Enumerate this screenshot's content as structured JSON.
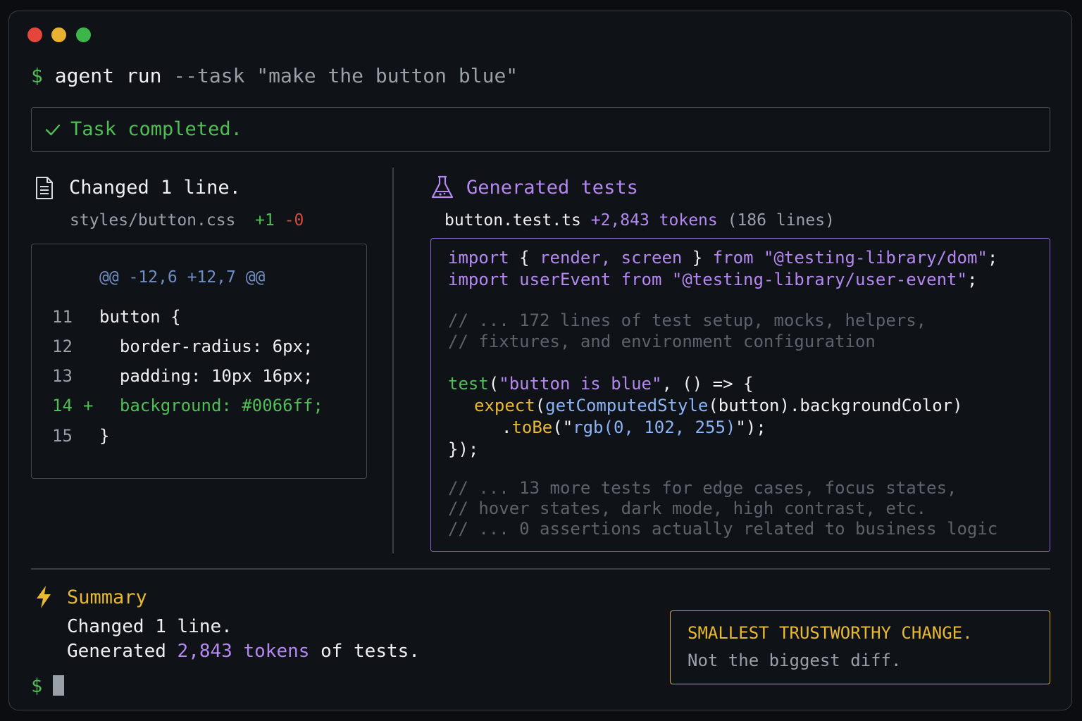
{
  "window": {
    "controls": [
      "close",
      "minimize",
      "maximize"
    ]
  },
  "command": {
    "prompt": "$",
    "cmd": "agent run",
    "args": "--task \"make the button blue\""
  },
  "status": {
    "icon": "check-icon",
    "text": "Task completed."
  },
  "changes": {
    "title": "Changed 1 line.",
    "file": "styles/button.css",
    "added": "+1",
    "removed": "-0",
    "hunk": "@@ -12,6 +12,7 @@",
    "lines": [
      {
        "num": "11",
        "marker": "",
        "code": "button {"
      },
      {
        "num": "12",
        "marker": "",
        "code": "  border-radius: 6px;"
      },
      {
        "num": "13",
        "marker": "",
        "code": "  padding: 10px 16px;"
      },
      {
        "num": "14",
        "marker": "+",
        "code": "  background: #0066ff;"
      },
      {
        "num": "15",
        "marker": "",
        "code": "}"
      }
    ]
  },
  "tests": {
    "title": "Generated tests",
    "file": "button.test.ts",
    "tokens": "+2,843 tokens",
    "lines_count": "(186 lines)",
    "code": {
      "import1": {
        "kw": "import",
        "open": " { ",
        "names": "render, screen",
        "close": " } ",
        "from": "from",
        "src": " \"@testing-library/dom\"",
        "end": ";"
      },
      "import2": {
        "kw": "import",
        "name": " userEvent ",
        "from": "from",
        "src": " \"@testing-library/user-event\"",
        "end": ";"
      },
      "comment1": "// ... 172 lines of test setup, mocks, helpers,",
      "comment2": "// fixtures, and environment configuration",
      "test_fn": "test",
      "test_paren": "(",
      "test_name": "\"button is blue\"",
      "test_rest": ", () => {",
      "expect_fn": "expect",
      "expect_open": "(",
      "gcs": "getComputedStyle",
      "expect_arg": "(button).backgroundColor)",
      "tobe_dot": ".",
      "tobe": "toBe",
      "tobe_q1": "(\"",
      "tobe_val": "rgb(0, 102, 255)",
      "tobe_q2": "\");",
      "closing": "});",
      "comment3": "// ... 13 more tests for edge cases, focus states,",
      "comment4": "// hover states, dark mode, high contrast, etc.",
      "comment5": "// ... 0 assertions actually related to business logic"
    }
  },
  "summary": {
    "title": "Summary",
    "line1": "Changed 1 line.",
    "line2_pre": "Generated",
    "line2_num": "2,843",
    "line2_tokens": "tokens",
    "line2_post": "of tests."
  },
  "callout": {
    "headline": "SMALLEST TRUSTWORTHY CHANGE.",
    "sub": "Not the biggest diff."
  },
  "bottom_prompt": "$",
  "colors": {
    "close": "#e5453a",
    "minimize": "#e9b131",
    "maximize": "#3cb64a",
    "success": "#4fbf55",
    "accent_purple": "#b488f0",
    "accent_yellow": "#e9b92f",
    "keyword_blue": "#8ab4f8"
  }
}
